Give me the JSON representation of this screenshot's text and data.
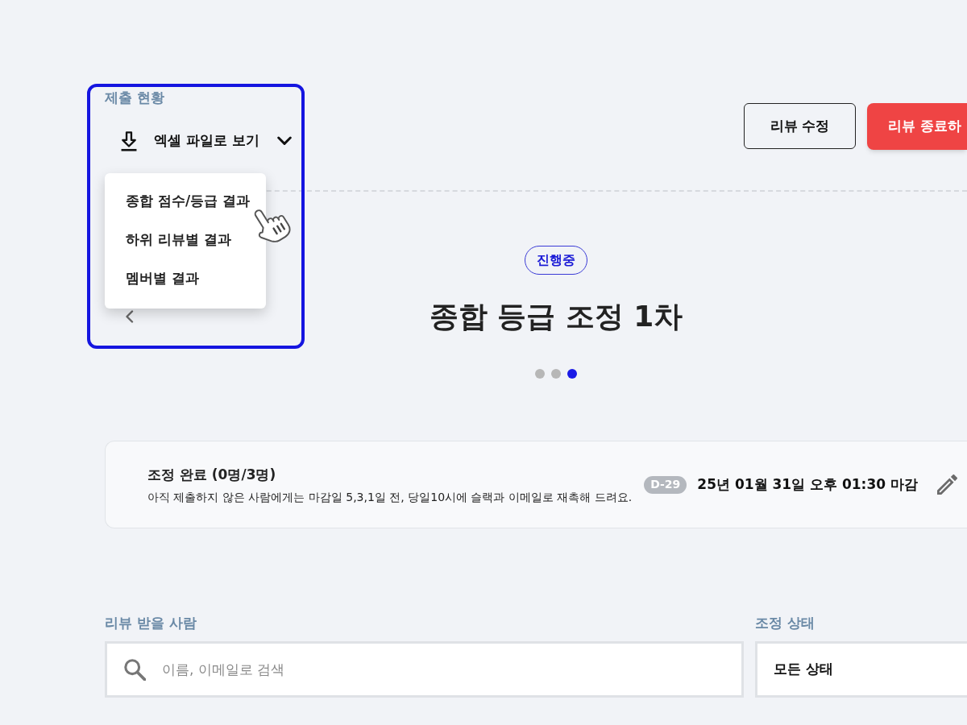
{
  "submission": {
    "label": "제출 현황",
    "download": {
      "label": "엑셀 파일로 보기",
      "expanded": true,
      "menu": [
        {
          "label": "종합 점수/등급 결과"
        },
        {
          "label": "하위 리뷰별 결과"
        },
        {
          "label": "멤버별 결과"
        }
      ]
    }
  },
  "actions": [
    {
      "label": "리뷰 수정",
      "kind": "outline"
    },
    {
      "label": "리뷰 종료하",
      "kind": "danger"
    }
  ],
  "round": {
    "status": "진행중",
    "title": "종합 등급 조정 1차",
    "dots": [
      {
        "selected": false
      },
      {
        "selected": false
      },
      {
        "selected": true
      }
    ]
  },
  "deadline_card": {
    "title": "조정 완료 (0명/3명)",
    "note": "아직 제출하지 않은 사람에게는 마감일 5,3,1일 전, 당일10시에 슬랙과 이메일로 재촉해 드려요.",
    "d_day": "D-29",
    "deadline": "25년 01월 31일 오후 01:30 마감"
  },
  "filters": {
    "reviewee": {
      "label": "리뷰 받을 사람",
      "placeholder": "이름, 이메일로 검색"
    },
    "status": {
      "label": "조정 상태",
      "value": "모든 상태"
    }
  }
}
